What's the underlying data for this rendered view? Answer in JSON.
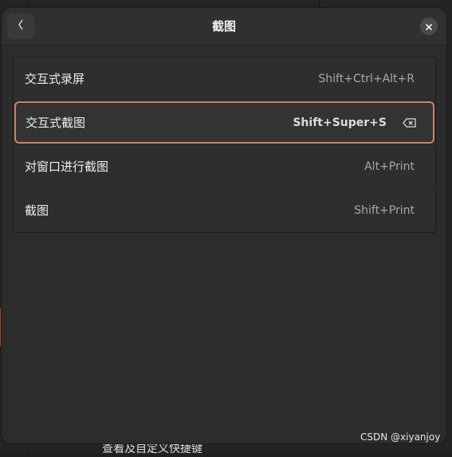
{
  "background": {
    "text": "查看及自定义快捷键"
  },
  "dialog": {
    "title": "截图",
    "back_icon": "chevron-left-icon",
    "close_icon": "close-icon"
  },
  "shortcuts": [
    {
      "label": "交互式录屏",
      "accel": "Shift+Ctrl+Alt+R"
    },
    {
      "label": "交互式截图",
      "accel": "Shift+Super+S",
      "selected": true
    },
    {
      "label": "对窗口进行截图",
      "accel": "Alt+Print"
    },
    {
      "label": "截图",
      "accel": "Shift+Print"
    }
  ],
  "selected_row": {
    "clear_icon": "backspace-icon"
  },
  "watermark": "CSDN @xiyanjoy",
  "colors": {
    "accent_border": "#c8836a",
    "dialog_bg": "#2c2c2c"
  }
}
